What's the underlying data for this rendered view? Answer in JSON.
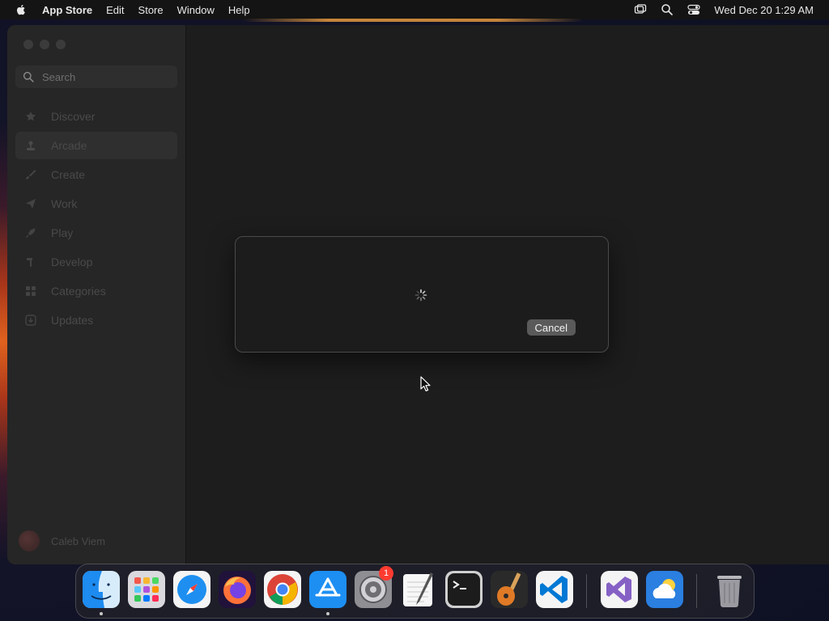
{
  "menubar": {
    "app_name": "App Store",
    "menus": [
      "Edit",
      "Store",
      "Window",
      "Help"
    ],
    "clock": "Wed Dec 20  1:29 AM"
  },
  "sidebar": {
    "search_placeholder": "Search",
    "items": [
      {
        "label": "Discover"
      },
      {
        "label": "Arcade"
      },
      {
        "label": "Create"
      },
      {
        "label": "Work"
      },
      {
        "label": "Play"
      },
      {
        "label": "Develop"
      },
      {
        "label": "Categories"
      },
      {
        "label": "Updates"
      }
    ],
    "selected_index": 1,
    "account_name": "Caleb Viem"
  },
  "modal": {
    "cancel_label": "Cancel"
  },
  "dock": {
    "settings_badge": "1"
  }
}
